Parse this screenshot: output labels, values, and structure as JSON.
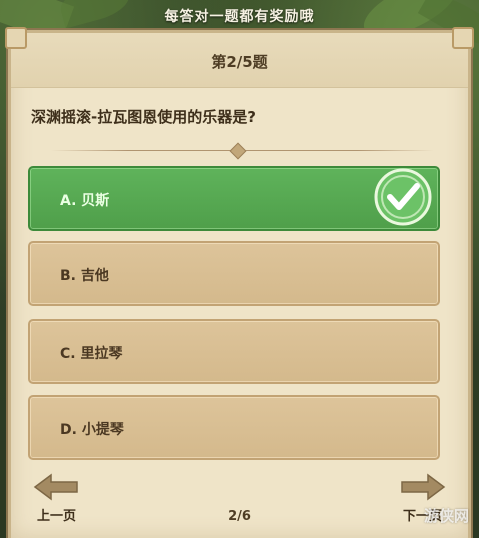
{
  "banner": {
    "text": "每答对一题都有奖励哦"
  },
  "quiz": {
    "question_number": "第2/5题",
    "question_text": "深渊摇滚-拉瓦图恩使用的乐器是?",
    "options": [
      {
        "label": "A. 贝斯",
        "state": "correct"
      },
      {
        "label": "B. 吉他",
        "state": "normal"
      },
      {
        "label": "C. 里拉琴",
        "state": "normal"
      },
      {
        "label": "D. 小提琴",
        "state": "normal"
      }
    ]
  },
  "navigation": {
    "prev_label": "上一页",
    "next_label": "下一页",
    "page_indicator": "2/6"
  },
  "watermark": {
    "text": "游侠网"
  },
  "colors": {
    "correct_green": "#5fb35b",
    "option_tan": "#d4b98c",
    "card_bg": "#efe4c8"
  }
}
